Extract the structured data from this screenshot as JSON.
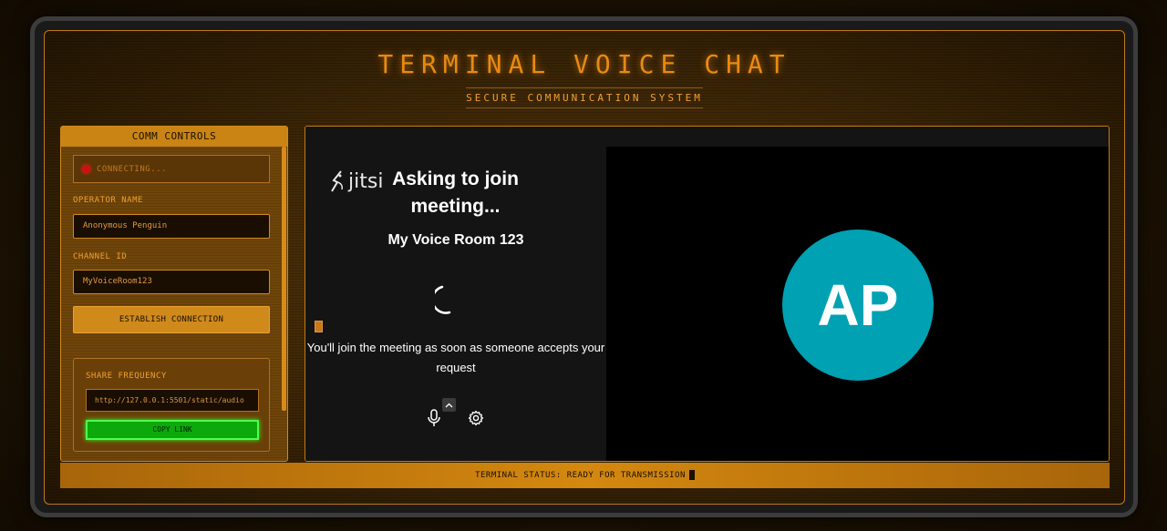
{
  "header": {
    "title": "TERMINAL VOICE CHAT",
    "subtitle": "SECURE COMMUNICATION SYSTEM"
  },
  "controls": {
    "heading": "COMM CONTROLS",
    "status": "CONNECTING...",
    "operator_label": "OPERATOR NAME",
    "operator_value": "Anonymous Penguin",
    "channel_label": "CHANNEL ID",
    "channel_value": "MyVoiceRoom123",
    "connect_button": "ESTABLISH CONNECTION",
    "share_label": "SHARE FREQUENCY",
    "share_value": "http://127.0.0.1:5501/static/audio",
    "copy_button": "COPY LINK"
  },
  "meeting": {
    "logo_text": "jitsi",
    "title": "Asking to join meeting...",
    "room_name": "My Voice Room 123",
    "message": "You'll join the meeting as soon as someone accepts your request",
    "avatar_initials": "AP"
  },
  "footer": {
    "status": "TERMINAL STATUS: READY FOR TRANSMISSION"
  },
  "colors": {
    "accent": "#d08a1c",
    "avatar": "#00a1b3",
    "copy_button": "#0ca80c",
    "status_dot": "#d01010"
  },
  "icons": [
    "jitsi-logo-icon",
    "spinner-icon",
    "microphone-icon",
    "chevron-up-icon",
    "gear-icon",
    "status-dot-icon"
  ]
}
